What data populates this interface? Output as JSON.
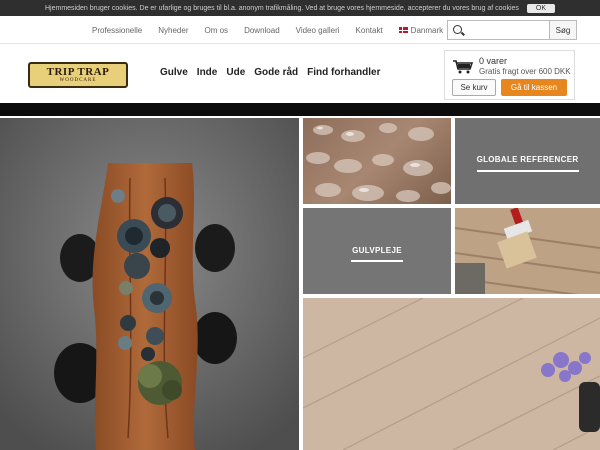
{
  "cookie": {
    "text": "Hjemmesiden bruger cookies. De er ufarlige og bruges til bl.a. anonym trafikmåling. Ved at bruge vores hjemmeside, accepterer du vores brug af cookies",
    "ok_label": "OK"
  },
  "topnav": {
    "items": [
      {
        "label": "Professionelle"
      },
      {
        "label": "Nyheder"
      },
      {
        "label": "Om os"
      },
      {
        "label": "Download"
      },
      {
        "label": "Video galleri"
      },
      {
        "label": "Kontakt"
      }
    ],
    "country": "Danmark"
  },
  "search": {
    "placeholder": "",
    "button_label": "Søg"
  },
  "logo": {
    "line1": "TRIP TRAP",
    "line2": "WOODCARE"
  },
  "mainnav": {
    "items": [
      {
        "label": "Gulve"
      },
      {
        "label": "Inde"
      },
      {
        "label": "Ude"
      },
      {
        "label": "Gode råd"
      },
      {
        "label": "Find forhandler"
      }
    ]
  },
  "cart": {
    "count_text": "0 varer",
    "shipping_text": "Gratis fragt over 600 DKK",
    "view_label": "Se kurv",
    "checkout_label": "Gå til kassen"
  },
  "tiles": {
    "global_label": "GLOBALE REFERENCER",
    "gulvpleje_label": "GULVPLEJE"
  },
  "colors": {
    "checkout": "#e7861e",
    "cookie_bar": "#2f2f2f",
    "tile_gray": "#707070"
  }
}
